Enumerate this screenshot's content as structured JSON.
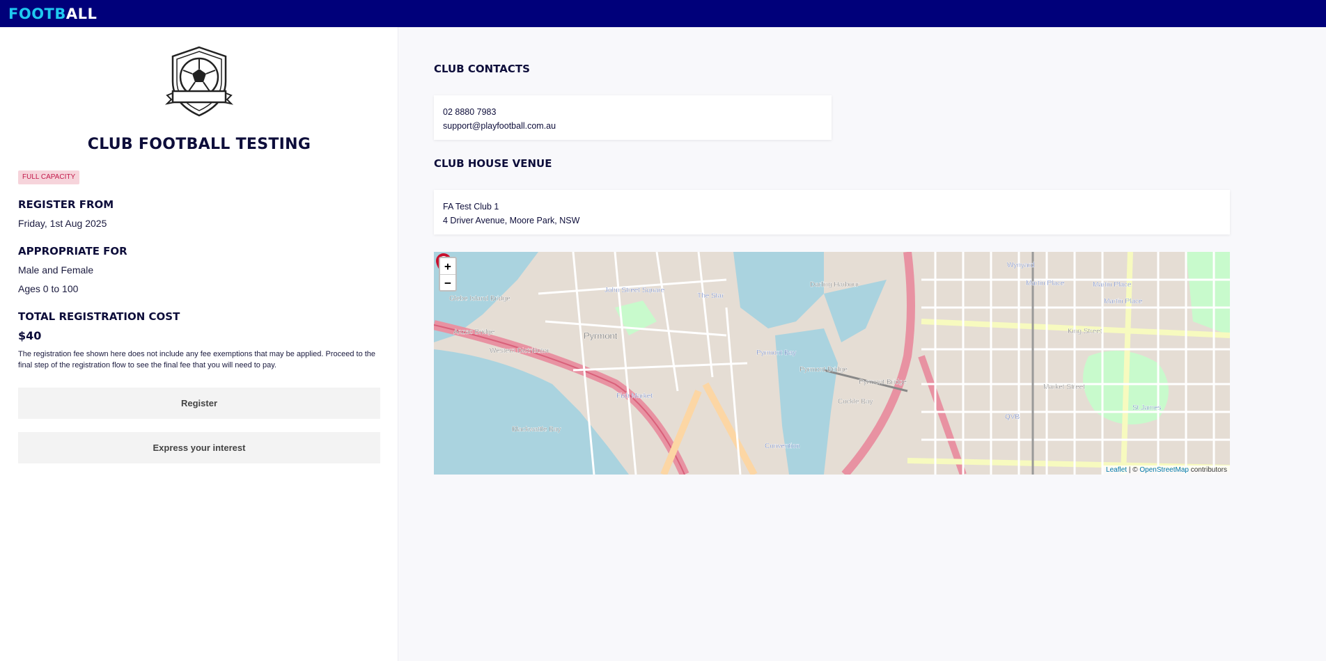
{
  "header": {
    "logo_part1": "FOOTB",
    "logo_part2": "ALL"
  },
  "club": {
    "name": "CLUB FOOTBALL TESTING",
    "status_badge": "FULL CAPACITY",
    "register_from_heading": "REGISTER FROM",
    "register_from_value": "Friday, 1st Aug 2025",
    "appropriate_heading": "APPROPRIATE FOR",
    "gender": "Male and Female",
    "ages": "Ages 0 to 100",
    "cost_heading": "TOTAL REGISTRATION COST",
    "cost_value": "$40",
    "fee_note": "The registration fee shown here does not include any fee exemptions that may be applied. Proceed to the final step of the registration flow to see the final fee that you will need to pay.",
    "register_button": "Register",
    "interest_button": "Express your interest"
  },
  "contacts": {
    "heading": "CLUB CONTACTS",
    "phone": "02 8880 7983",
    "email": "support@playfootball.com.au"
  },
  "venue": {
    "heading": "CLUB HOUSE VENUE",
    "name": "FA Test Club 1",
    "address": "4 Driver Avenue, Moore Park, NSW"
  },
  "map": {
    "zoom_in": "+",
    "zoom_out": "−",
    "attribution_leaflet": "Leaflet",
    "attribution_sep": " | © ",
    "attribution_osm": "OpenStreetMap",
    "attribution_tail": " contributors",
    "labels": {
      "glebe": "Glebe Island Bridge",
      "anzac": "Anzac Bridge",
      "pyrmont": "Pyrmont",
      "pyrmont_bay": "Pyrmont Bay",
      "pyrmont_bridge": "Pyrmont Bridge",
      "pyrmont_bridge2": "Pyrmont Bridge",
      "john_street": "John Street Square",
      "the_star": "The Star",
      "fish_market": "Fish Market",
      "wynyard": "Wynyard",
      "martin_place": "Martin Place",
      "martin_place2": "Martin Place",
      "martin_place3": "Martin Place",
      "st_james": "St James",
      "qvb": "QVB",
      "convention": "Convention",
      "cockle_bay": "Cockle Bay",
      "darling_harbour": "Darling Harbour",
      "blackwattle_bay": "Blackwattle Bay",
      "western_distributor": "Western Distributor",
      "market_street": "Market Street",
      "king_street": "King Street"
    },
    "colors": {
      "water": "#aad3df",
      "land": "#e5ddd4",
      "road_major": "#e892a2",
      "road_minor": "#ffffff",
      "park": "#c8facc",
      "pin": "#c8102e"
    }
  }
}
